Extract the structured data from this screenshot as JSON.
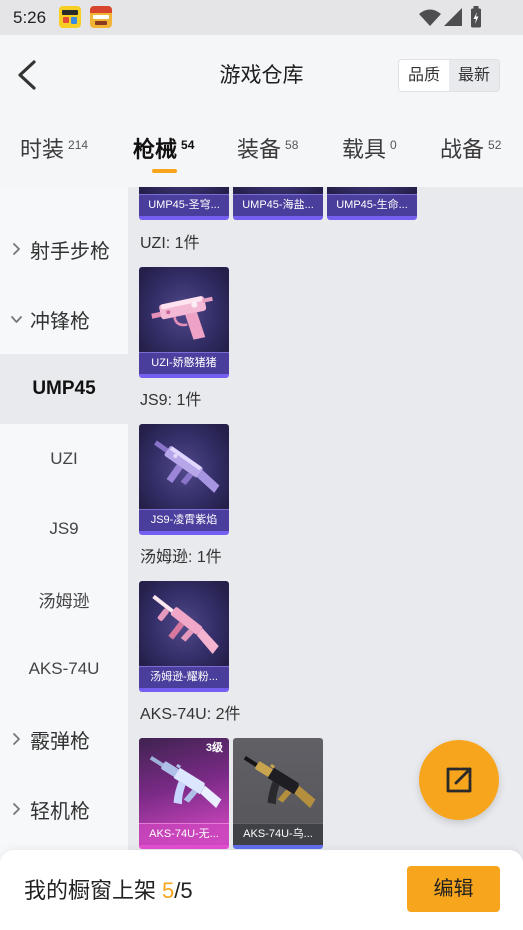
{
  "status_bar": {
    "time": "5:26"
  },
  "header": {
    "title": "游戏仓库",
    "sort": [
      {
        "label": "品质",
        "active": true
      },
      {
        "label": "最新",
        "active": false
      }
    ]
  },
  "tabs": [
    {
      "label": "时装",
      "count": "214",
      "active": false
    },
    {
      "label": "枪械",
      "count": "54",
      "active": true
    },
    {
      "label": "装备",
      "count": "58",
      "active": false
    },
    {
      "label": "载具",
      "count": "0",
      "active": false
    },
    {
      "label": "战备",
      "count": "52",
      "active": false
    }
  ],
  "sidebar": {
    "items": [
      {
        "label": "射手步枪",
        "is_category": true,
        "expanded": false
      },
      {
        "label": "冲锋枪",
        "is_category": true,
        "expanded": true
      },
      {
        "label": "UMP45",
        "is_category": false,
        "active": true
      },
      {
        "label": "UZI",
        "is_category": false,
        "active": false
      },
      {
        "label": "JS9",
        "is_category": false,
        "active": false
      },
      {
        "label": "汤姆逊",
        "is_category": false,
        "active": false
      },
      {
        "label": "AKS-74U",
        "is_category": false,
        "active": false
      },
      {
        "label": "霰弹枪",
        "is_category": true,
        "expanded": false
      },
      {
        "label": "轻机枪",
        "is_category": true,
        "expanded": false
      }
    ]
  },
  "content": {
    "groups": [
      {
        "items": [
          {
            "name": "UMP45-圣穹...",
            "rarity_color": "#7360F0"
          },
          {
            "name": "UMP45-海盐...",
            "rarity_color": "#7360F0"
          },
          {
            "name": "UMP45-生命...",
            "rarity_color": "#7360F0"
          }
        ]
      },
      {
        "title": "UZI: 1件",
        "items": [
          {
            "name": "UZI-娇憨猪猪",
            "rarity_color": "#7360F0"
          }
        ]
      },
      {
        "title": "JS9: 1件",
        "items": [
          {
            "name": "JS9-凌霄紫焰",
            "rarity_color": "#7360F0"
          }
        ]
      },
      {
        "title": "汤姆逊: 1件",
        "items": [
          {
            "name": "汤姆逊-耀粉...",
            "rarity_color": "#7360F0"
          }
        ]
      },
      {
        "title": "AKS-74U: 2件",
        "items": [
          {
            "name": "AKS-74U-无...",
            "level": "3级",
            "rarity_color": "#E44FD3"
          },
          {
            "name": "AKS-74U-乌...",
            "rarity_color": "#6070F0"
          }
        ]
      }
    ]
  },
  "fab": {
    "icon": "share-icon"
  },
  "showcase_bar": {
    "label": "我的橱窗上架",
    "used": "5",
    "rest": "/5",
    "edit_label": "编辑"
  },
  "colors": {
    "accent": "#F7A51C"
  }
}
